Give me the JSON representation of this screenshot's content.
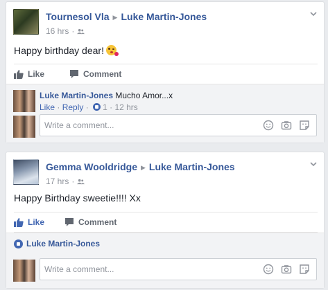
{
  "posts": [
    {
      "author": "Tournesol Vla",
      "target": "Luke Martin-Jones",
      "time": "16 hrs",
      "separator": "·",
      "text": "Happy birthday dear!",
      "emoji": "kissing-face-emoji",
      "actions": {
        "like": "Like",
        "comment": "Comment"
      },
      "liked": false,
      "comment": {
        "author": "Luke Martin-Jones",
        "text": "Mucho Amor...x",
        "like_link": "Like",
        "reply_link": "Reply",
        "dot": "·",
        "reaction_count": "1",
        "time": "12 hrs"
      },
      "write_placeholder": "Write a comment..."
    },
    {
      "author": "Gemma Wooldridge",
      "target": "Luke Martin-Jones",
      "time": "17 hrs",
      "separator": "·",
      "text": "Happy Birthday sweetie!!!! Xx",
      "actions": {
        "like": "Like",
        "comment": "Comment"
      },
      "liked": true,
      "likes_summary": "Luke Martin-Jones",
      "write_placeholder": "Write a comment..."
    }
  ],
  "colors": {
    "link": "#365899",
    "liked": "#4267b2",
    "muted": "#90949c",
    "page_bg": "#e9ebee"
  }
}
